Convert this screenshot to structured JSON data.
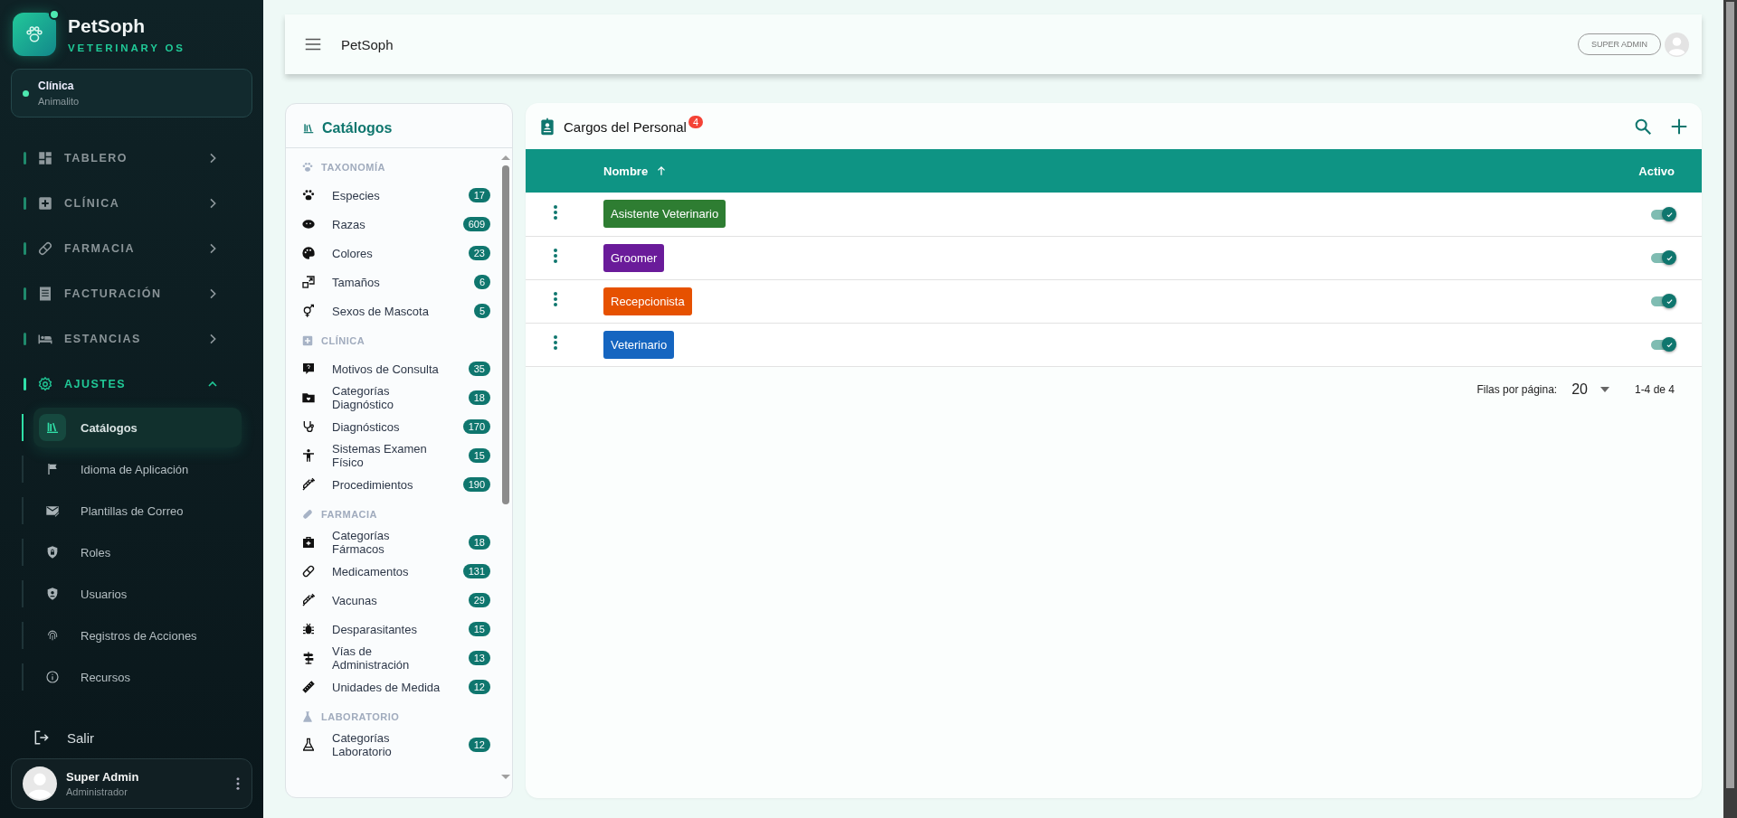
{
  "brand": {
    "name": "PetSoph",
    "subtitle": "VETERINARY OS"
  },
  "clinic": {
    "label": "Clínica",
    "name": "Animalito"
  },
  "nav": [
    {
      "label": "TABLERO",
      "expanded": false
    },
    {
      "label": "CLÍNICA",
      "expanded": false
    },
    {
      "label": "FARMACIA",
      "expanded": false
    },
    {
      "label": "FACTURACIÓN",
      "expanded": false
    },
    {
      "label": "ESTANCIAS",
      "expanded": false
    },
    {
      "label": "AJUSTES",
      "expanded": true,
      "children": [
        {
          "label": "Catálogos",
          "selected": true
        },
        {
          "label": "Idioma de Aplicación",
          "selected": false
        },
        {
          "label": "Plantillas de Correo",
          "selected": false
        },
        {
          "label": "Roles",
          "selected": false
        },
        {
          "label": "Usuarios",
          "selected": false
        },
        {
          "label": "Registros de Acciones",
          "selected": false
        },
        {
          "label": "Recursos",
          "selected": false
        }
      ]
    }
  ],
  "logout": "Salir",
  "user": {
    "name": "Super Admin",
    "role": "Administrador"
  },
  "header": {
    "title": "PetSoph",
    "role_badge": "SUPER ADMIN"
  },
  "catalogs": {
    "title": "Catálogos",
    "groups": [
      {
        "label": "TAXONOMÍA",
        "items": [
          {
            "label": "Especies",
            "count": "17"
          },
          {
            "label": "Razas",
            "count": "609"
          },
          {
            "label": "Colores",
            "count": "23"
          },
          {
            "label": "Tamaños",
            "count": "6"
          },
          {
            "label": "Sexos de Mascota",
            "count": "5"
          }
        ]
      },
      {
        "label": "CLÍNICA",
        "items": [
          {
            "label": "Motivos de Consulta",
            "count": "35"
          },
          {
            "label": "Categorías Diagnóstico",
            "count": "18"
          },
          {
            "label": "Diagnósticos",
            "count": "170"
          },
          {
            "label": "Sistemas Examen Físico",
            "count": "15"
          },
          {
            "label": "Procedimientos",
            "count": "190"
          }
        ]
      },
      {
        "label": "FARMACIA",
        "items": [
          {
            "label": "Categorías Fármacos",
            "count": "18"
          },
          {
            "label": "Medicamentos",
            "count": "131"
          },
          {
            "label": "Vacunas",
            "count": "29"
          },
          {
            "label": "Desparasitantes",
            "count": "15"
          },
          {
            "label": "Vías de Administración",
            "count": "13"
          },
          {
            "label": "Unidades de Medida",
            "count": "12"
          }
        ]
      },
      {
        "label": "LABORATORIO",
        "items": [
          {
            "label": "Categorías Laboratorio",
            "count": "12"
          }
        ]
      }
    ]
  },
  "table": {
    "title": "Cargos del Personal",
    "count": "4",
    "columns": [
      {
        "label": "Nombre",
        "sorted": true
      },
      {
        "label": "Activo",
        "sorted": false
      }
    ],
    "rows": [
      {
        "name": "Asistente Veterinario",
        "color": "#2e7d32",
        "active": true
      },
      {
        "name": "Groomer",
        "color": "#6a1b9a",
        "active": true
      },
      {
        "name": "Recepcionista",
        "color": "#e65100",
        "active": true
      },
      {
        "name": "Veterinario",
        "color": "#1565c0",
        "active": true
      }
    ],
    "pagination": {
      "rows_per_page_label": "Filas por página:",
      "rows_per_page": "20",
      "range": "1-4 de 4"
    }
  }
}
